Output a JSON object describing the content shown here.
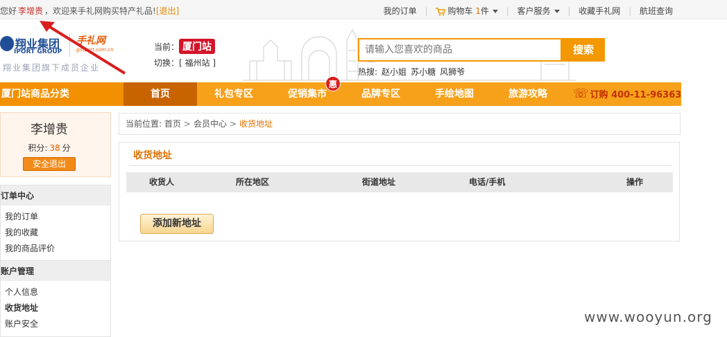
{
  "topbar": {
    "greeting_prefix": "您好",
    "username": "李增贵",
    "greeting_suffix": "，欢迎来手礼网购买特产礼品!",
    "logout": "[退出]",
    "links": {
      "my_orders": "我的订单",
      "cart_label": "购物车",
      "cart_count": "1",
      "cart_unit": "件",
      "service": "客户服务",
      "favorite": "收藏手礼网",
      "flight": "航班查询"
    }
  },
  "header": {
    "logo_cn": "翔业集团",
    "logo_en": "IPORT GROUP",
    "logo_sub": "翔业集团旗下成员企业",
    "logo2": "手礼网",
    "logo2_en": "giftport.com.cn",
    "station_label": "当前：",
    "station_name": "厦门站",
    "switch_label": "切换：[",
    "switch_city": "福州站",
    "switch_close": "]",
    "search_placeholder": "请输入您喜欢的商品",
    "search_button": "搜索",
    "hot_label": "热搜:",
    "hot_items": [
      "赵小姐",
      "苏小糖",
      "风狮爷"
    ]
  },
  "nav": {
    "category": "厦门站商品分类",
    "items": [
      "首页",
      "礼包专区",
      "促销集市",
      "品牌专区",
      "手绘地图",
      "旅游攻略"
    ],
    "hui_badge": "惠",
    "hotline_label": "订购",
    "hotline_number": "400-11-96363"
  },
  "user": {
    "name": "李增贵",
    "points_label": "积分:",
    "points_value": "38",
    "points_unit": "分",
    "logout_button": "安全退出"
  },
  "menu": {
    "sections": [
      {
        "title": "订单中心",
        "items": [
          "我的订单",
          "我的收藏",
          "我的商品评价"
        ]
      },
      {
        "title": "账户管理",
        "items": [
          "个人信息",
          "收货地址",
          "账户安全"
        ]
      }
    ],
    "active": "收货地址"
  },
  "breadcrumb": {
    "prefix": "当前位置:",
    "items": [
      "首页",
      "会员中心"
    ],
    "current": "收货地址"
  },
  "address": {
    "title": "收货地址",
    "columns": [
      "收货人",
      "所在地区",
      "街道地址",
      "电话/手机",
      "操作"
    ],
    "add_button": "添加新地址"
  },
  "watermark": "www.wooyun.org",
  "colors": {
    "accent": "#f7a11a",
    "nav_active": "#c86400",
    "brand_red": "#d3152a",
    "link_orange": "#e07000"
  }
}
